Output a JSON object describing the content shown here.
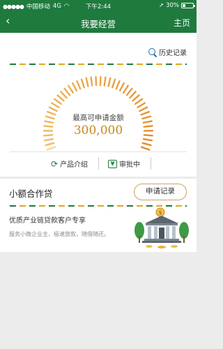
{
  "status_bar": {
    "carrier": "中国移动",
    "network": "4G",
    "time": "下午2:44",
    "battery_text": "30%",
    "battery_level": 0.3
  },
  "nav": {
    "back_icon": "chevron-left-icon",
    "title": "我要经营",
    "home_label": "主页"
  },
  "limit": {
    "history_label": "历史记录",
    "label": "最高可申请金额",
    "amount": "300,000",
    "product_intro_label": "产品介绍",
    "approval_status_label": "审批中",
    "approval_icon_glyph": "¥"
  },
  "loan_card": {
    "title": "小额合作贷",
    "apply_record_label": "申请记录",
    "subtitle": "优质产业链贷款客户专享",
    "description": "服务小微企业主，极速放款，随借随还。"
  },
  "colors": {
    "primary_green": "#1f7a3e",
    "accent_gold": "#e0a81c",
    "amount_color": "#c8891a"
  }
}
